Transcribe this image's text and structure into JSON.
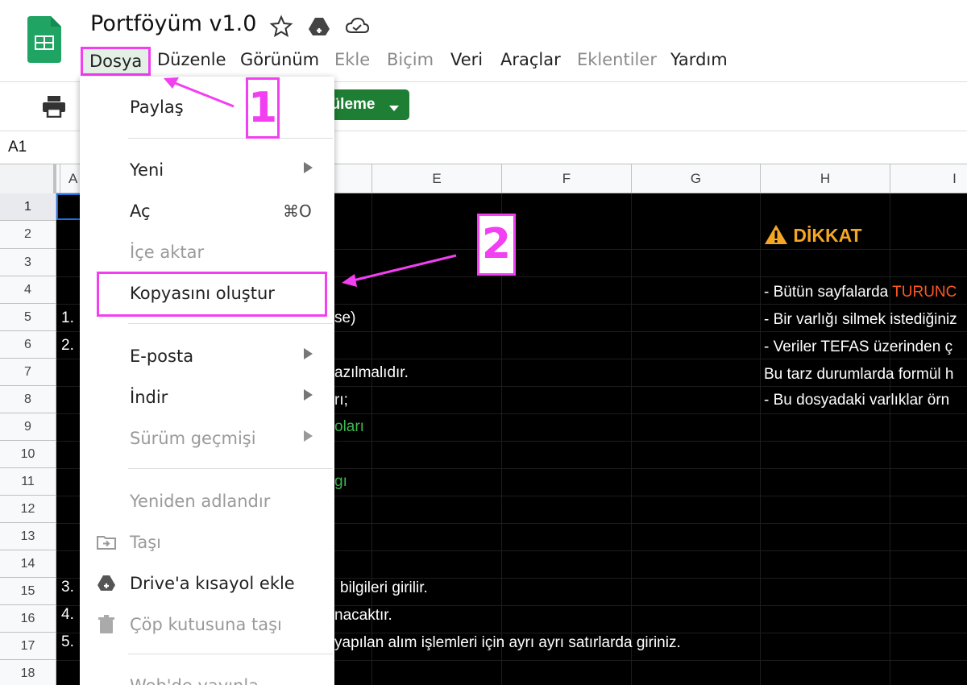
{
  "header": {
    "title": "Portföyüm v1.0",
    "icons": [
      "sheets-logo-icon",
      "star-icon",
      "drive-move-icon",
      "cloud-status-icon"
    ]
  },
  "menubar": {
    "items": [
      {
        "label": "Dosya",
        "state": "active"
      },
      {
        "label": "Düzenle",
        "state": "enabled"
      },
      {
        "label": "Görünüm",
        "state": "enabled"
      },
      {
        "label": "Ekle",
        "state": "disabled"
      },
      {
        "label": "Biçim",
        "state": "disabled"
      },
      {
        "label": "Veri",
        "state": "enabled"
      },
      {
        "label": "Araçlar",
        "state": "enabled"
      },
      {
        "label": "Eklentiler",
        "state": "disabled"
      },
      {
        "label": "Yardım",
        "state": "enabled"
      }
    ]
  },
  "toolbar": {
    "green_button_label": "küleme",
    "print_icon": "print-icon"
  },
  "formula_bar": {
    "cell_ref": "A1"
  },
  "grid": {
    "columns": [
      "A",
      "E",
      "F",
      "G",
      "H",
      "I"
    ],
    "rows": [
      "1",
      "2",
      "3",
      "4",
      "5",
      "6",
      "7",
      "8",
      "9",
      "10",
      "11",
      "12",
      "13",
      "14",
      "15",
      "16",
      "17",
      "18"
    ],
    "cells": {
      "r5_a": "1.",
      "r6_a": "2.",
      "r15_a": "3.",
      "r16_a": "4.",
      "r17_a": "5.",
      "r5_d": "se)",
      "r7_d": "azılmalıdır.",
      "r8_d": "rı;",
      "r9_d": "oları",
      "r11_d": "gı",
      "r15_d": "bilgileri girilir.",
      "r16_d": "nacaktır.",
      "r17_d": "yapılan alım işlemleri için ayrı ayrı satırlarda giriniz.",
      "warning_title": "DİKKAT",
      "r4_h_prefix": "- Bütün sayfalarda ",
      "r4_h_orange": "TURUNC",
      "r5_h": "- Bir varlığı silmek istediğiniz",
      "r6_h": "- Veriler TEFAS üzerinden ç",
      "r7_h": "Bu tarz durumlarda formül h",
      "r8_h": "- Bu dosyadaki varlıklar örn"
    }
  },
  "file_menu": {
    "items": [
      {
        "label": "Paylaş",
        "state": "enabled"
      },
      {
        "label": "Yeni",
        "state": "enabled",
        "submenu": true
      },
      {
        "label": "Aç",
        "state": "enabled",
        "shortcut": "⌘O"
      },
      {
        "label": "İçe aktar",
        "state": "disabled"
      },
      {
        "label": "Kopyasını oluştur",
        "state": "enabled",
        "highlighted": true
      },
      {
        "label": "E-posta",
        "state": "enabled",
        "submenu": true
      },
      {
        "label": "İndir",
        "state": "enabled",
        "submenu": true
      },
      {
        "label": "Sürüm geçmişi",
        "state": "disabled",
        "submenu": true
      },
      {
        "label": "Yeniden adlandır",
        "state": "disabled"
      },
      {
        "label": "Taşı",
        "state": "disabled",
        "icon": "folder-move-icon"
      },
      {
        "label": "Drive'a kısayol ekle",
        "state": "enabled",
        "icon": "drive-shortcut-icon"
      },
      {
        "label": "Çöp kutusuna taşı",
        "state": "disabled",
        "icon": "trash-icon"
      },
      {
        "label": "Web'de yayınla",
        "state": "disabled"
      }
    ]
  },
  "annotations": {
    "step1": "1",
    "step2": "2",
    "color": "#f23ff2"
  },
  "colors": {
    "sheet_background": "#000000",
    "green_button": "#1e7e34",
    "warning": "#f5a623",
    "orange_text": "#ff5722",
    "text_green": "#3fb950",
    "selection": "#1a73e8"
  }
}
